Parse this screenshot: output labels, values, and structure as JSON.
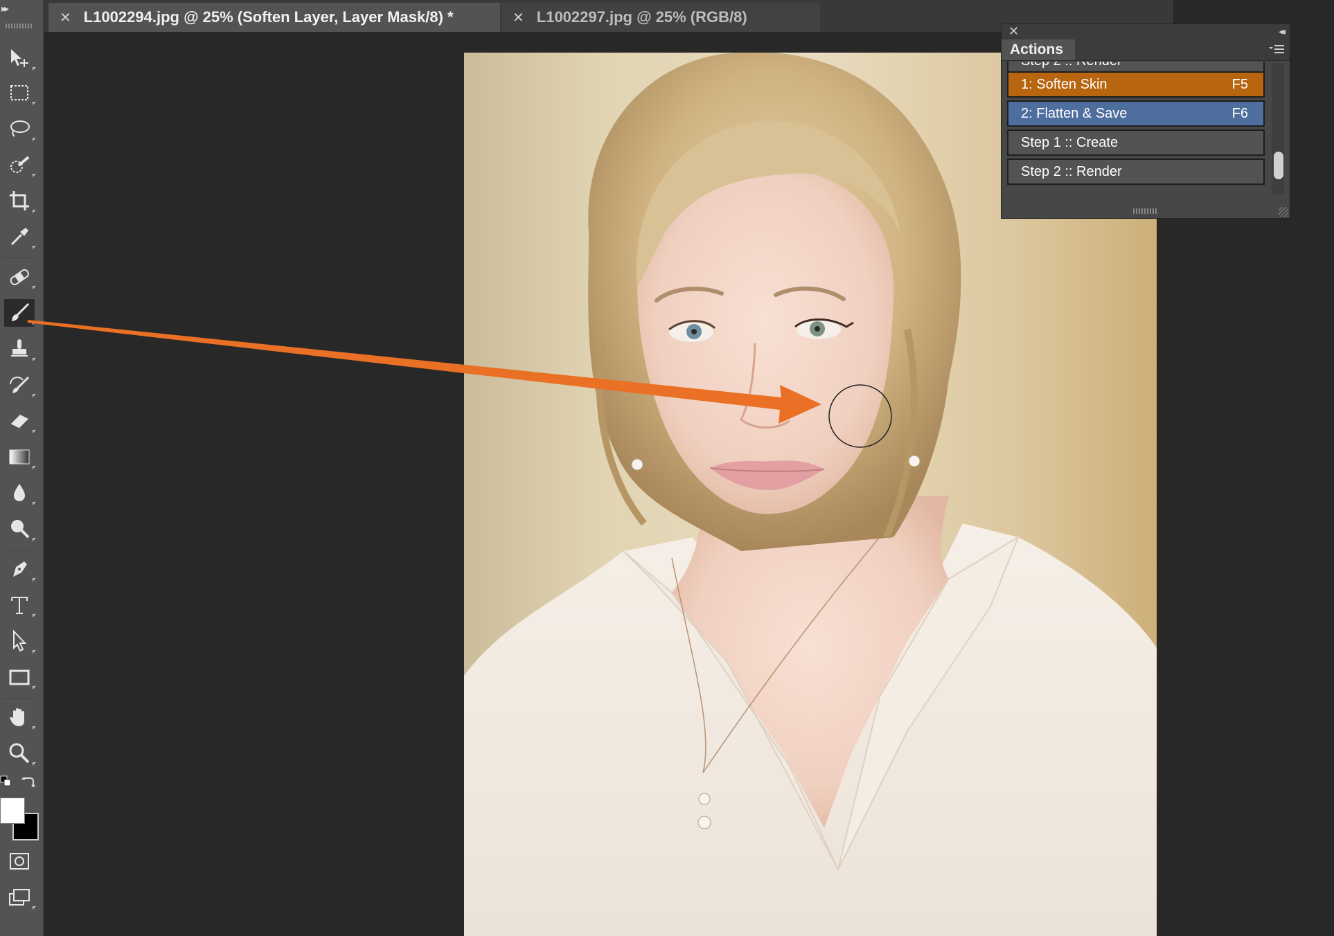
{
  "tabs": [
    {
      "label": "L1002294.jpg @ 25% (Soften Layer, Layer Mask/8) *",
      "active": true
    },
    {
      "label": "L1002297.jpg @ 25% (RGB/8)",
      "active": false
    }
  ],
  "actions_panel": {
    "title": "Actions",
    "items": [
      {
        "label": "Step 2 :: Render",
        "key": "",
        "color": "#535353"
      },
      {
        "label": "1: Soften Skin",
        "key": "F5",
        "color": "#b7650f"
      },
      {
        "label": "2: Flatten & Save",
        "key": "F6",
        "color": "#4e6e9e"
      },
      {
        "label": "Step 1 :: Create",
        "key": "",
        "color": "#535353"
      },
      {
        "label": "Step 2 :: Render",
        "key": "",
        "color": "#535353"
      }
    ]
  },
  "tools": [
    "move-tool-icon",
    "marquee-tool-icon",
    "lasso-tool-icon",
    "quick-selection-tool-icon",
    "crop-tool-icon",
    "eyedropper-tool-icon",
    "healing-brush-tool-icon",
    "brush-tool-icon",
    "clone-stamp-tool-icon",
    "history-brush-tool-icon",
    "eraser-tool-icon",
    "gradient-tool-icon",
    "blur-tool-icon",
    "dodge-tool-icon",
    "pen-tool-icon",
    "type-tool-icon",
    "path-selection-tool-icon",
    "rectangle-tool-icon",
    "hand-tool-icon",
    "zoom-tool-icon"
  ],
  "colors": {
    "arrow": "#ea7025",
    "foreground": "#ffffff",
    "background": "#000000"
  }
}
